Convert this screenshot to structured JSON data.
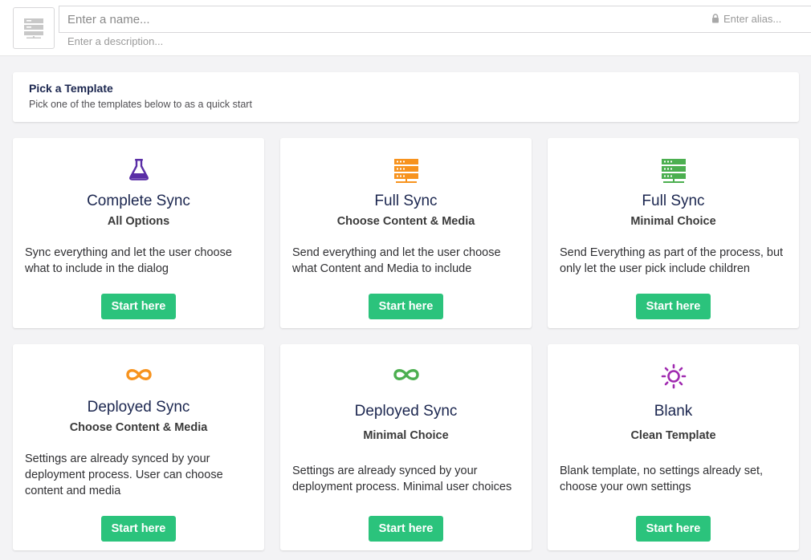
{
  "header": {
    "name_placeholder": "Enter a name...",
    "alias_placeholder": "Enter alias...",
    "description_placeholder": "Enter a description...",
    "icon": "server-icon"
  },
  "intro": {
    "title": "Pick a Template",
    "subtitle": "Pick one of the templates below to as a quick start"
  },
  "colors": {
    "button": "#2bc37c",
    "purple": "#5a2ea6",
    "orange": "#f7931e",
    "green": "#4caf50",
    "magenta": "#a02bb0"
  },
  "cards": [
    {
      "icon": "flask-icon",
      "title": "Complete Sync",
      "subtitle": "All Options",
      "description": "Sync everything and let the user choose what to include in the dialog",
      "button": "Start here"
    },
    {
      "icon": "server-icon",
      "title": "Full Sync",
      "subtitle": "Choose Content & Media",
      "description": "Send everything and let the user choose what Content and Media to include",
      "button": "Start here"
    },
    {
      "icon": "server-icon",
      "title": "Full Sync",
      "subtitle": "Minimal Choice",
      "description": "Send Everything as part of the process, but only let the user pick include children",
      "button": "Start here"
    },
    {
      "icon": "infinity-icon",
      "title": "Deployed Sync",
      "subtitle": "Choose Content & Media",
      "description": "Settings are already synced by your deployment process. User can choose content and media",
      "button": "Start here"
    },
    {
      "icon": "infinity-icon",
      "title": "Deployed Sync",
      "subtitle": "Minimal Choice",
      "description": "Settings are already synced by your deployment process. Minimal user choices",
      "button": "Start here"
    },
    {
      "icon": "sun-icon",
      "title": "Blank",
      "subtitle": "Clean Template",
      "description": "Blank template, no settings already set, choose your own settings",
      "button": "Start here"
    }
  ]
}
